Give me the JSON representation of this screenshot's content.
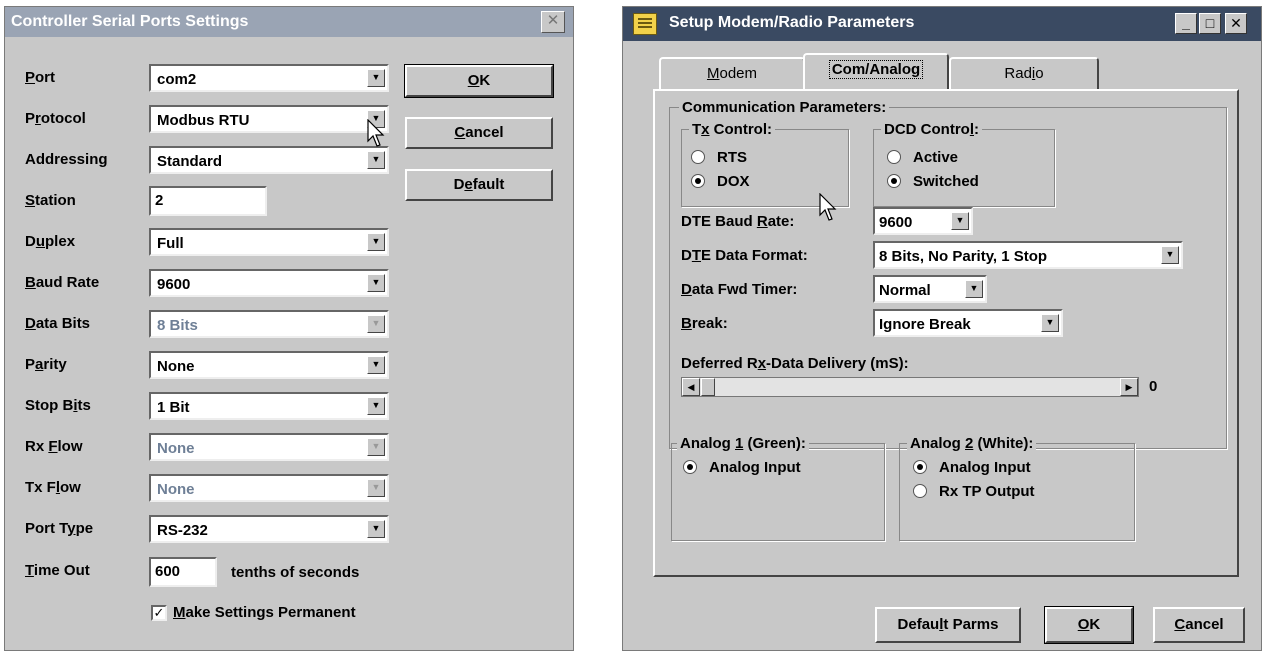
{
  "left_dialog": {
    "title": "Controller Serial Ports Settings",
    "close_glyph": "✕",
    "fields": [
      {
        "label_pre": "",
        "label_u": "P",
        "label_post": "ort",
        "value": "com2",
        "disabled": false
      },
      {
        "label_pre": "P",
        "label_u": "r",
        "label_post": "otocol",
        "value": "Modbus RTU",
        "disabled": false
      },
      {
        "label_pre": "Addressin",
        "label_u": "g",
        "label_post": "",
        "value": "Standard",
        "disabled": false
      },
      {
        "label_pre": "",
        "label_u": "S",
        "label_post": "tation",
        "value": "2",
        "disabled": false
      },
      {
        "label_pre": "D",
        "label_u": "u",
        "label_post": "plex",
        "value": "Full",
        "disabled": false
      },
      {
        "label_pre": "",
        "label_u": "B",
        "label_post": "aud Rate",
        "value": "9600",
        "disabled": false
      },
      {
        "label_pre": "",
        "label_u": "D",
        "label_post": "ata Bits",
        "value": "8 Bits",
        "disabled": true
      },
      {
        "label_pre": "P",
        "label_u": "a",
        "label_post": "rity",
        "value": "None",
        "disabled": false
      },
      {
        "label_pre": "Stop B",
        "label_u": "i",
        "label_post": "ts",
        "value": "1 Bit",
        "disabled": false
      },
      {
        "label_pre": "Rx ",
        "label_u": "F",
        "label_post": "low",
        "value": "None",
        "disabled": true
      },
      {
        "label_pre": "Tx F",
        "label_u": "l",
        "label_post": "ow",
        "value": "None",
        "disabled": true
      },
      {
        "label_pre": "Port T",
        "label_u": "y",
        "label_post": "pe",
        "value": "RS-232",
        "disabled": false
      }
    ],
    "timeout": {
      "label_u": "T",
      "label_post": "ime Out",
      "value": "600",
      "suffix": "tenths of seconds"
    },
    "permanent": {
      "checked_glyph": "✓",
      "label_u": "M",
      "label_post": "ake Settings Permanent"
    },
    "buttons": {
      "ok": {
        "u": "O",
        "post": "K"
      },
      "cancel": {
        "u": "C",
        "post": "ancel"
      },
      "default": {
        "pre": "D",
        "u": "e",
        "post": "fault"
      }
    }
  },
  "right_dialog": {
    "title": "Setup Modem/Radio Parameters",
    "win_buttons": {
      "min": "_",
      "max": "□",
      "close": "✕"
    },
    "tabs": {
      "modem": {
        "u": "M",
        "post": "odem"
      },
      "com_analog": {
        "label": "Com/Analog"
      },
      "radio": {
        "pre": "Rad",
        "u": "i",
        "post": "o"
      }
    },
    "comm_group_title": "Communication Parameters:",
    "tx_control": {
      "title_pre": "T",
      "title_u": "x",
      "title_post": " Control:",
      "options": [
        "RTS",
        "DOX"
      ],
      "selected": 1
    },
    "dcd_control": {
      "title_pre": "DCD Contro",
      "title_u": "l",
      "title_post": ":",
      "options": [
        "Active",
        "Switched"
      ],
      "selected": 1
    },
    "dte_baud": {
      "pre": "DTE Baud ",
      "u": "R",
      "post": "ate:",
      "value": "9600"
    },
    "dte_format": {
      "pre": "D",
      "u": "T",
      "post": "E Data Format:",
      "value": "8 Bits, No Parity, 1 Stop"
    },
    "fwd_timer": {
      "u": "D",
      "post": "ata Fwd Timer:",
      "value": "Normal"
    },
    "break_field": {
      "u": "B",
      "post": "reak:",
      "value": "Ignore Break"
    },
    "deferred": {
      "pre": "Deferred R",
      "u": "x",
      "post": "-Data Delivery (mS):",
      "value": "0",
      "level": 0
    },
    "analog1": {
      "title_pre": "Analog ",
      "title_u": "1",
      "title_post": " (Green):",
      "options": [
        "Analog Input"
      ],
      "selected": 0
    },
    "analog2": {
      "title_pre": "Analog ",
      "title_u": "2",
      "title_post": " (White):",
      "options": [
        "Analog Input",
        "Rx TP Output"
      ],
      "selected": 0
    },
    "buttons": {
      "default_parms": {
        "pre": "Defau",
        "u": "l",
        "post": "t Parms"
      },
      "ok": {
        "u": "O",
        "post": "K"
      },
      "cancel": {
        "u": "C",
        "post": "ancel"
      }
    }
  }
}
